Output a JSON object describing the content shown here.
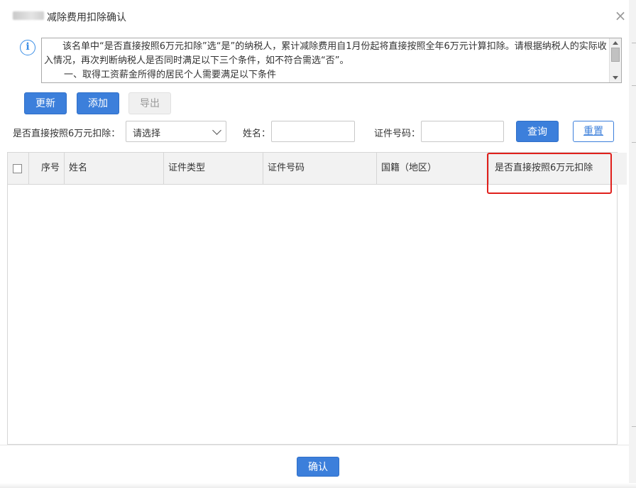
{
  "dialog": {
    "title": "减除费用扣除确认",
    "close_glyph": "×"
  },
  "notice": {
    "icon": "info-icon",
    "lines": [
      "该名单中“是否直接按照6万元扣除”选“是”的纳税人，累计减除费用自1月份起将直接按照全年6万元计算扣除。请根据纳税人的实际收入情况，再次判断纳税人是否同时满足以下三个条件，如不符合需选“否”。",
      "一、取得工资薪金所得的居民个人需要满足以下条件"
    ]
  },
  "toolbar": {
    "update_label": "更新",
    "add_label": "添加",
    "export_label": "导出"
  },
  "filters": {
    "deduct_label": "是否直接按照6万元扣除：",
    "deduct_value": "请选择",
    "name_label": "姓名：",
    "name_value": "",
    "id_label": "证件号码：",
    "id_value": "",
    "query_label": "查询",
    "reset_label": "重置"
  },
  "table": {
    "columns": [
      "序号",
      "姓名",
      "证件类型",
      "证件号码",
      "国籍（地区）",
      "是否直接按照6万元扣除"
    ],
    "rows": []
  },
  "footer": {
    "confirm_label": "确认"
  },
  "colors": {
    "primary": "#3c7fdb",
    "highlight": "#e0201c",
    "info": "#3a8ee6"
  }
}
